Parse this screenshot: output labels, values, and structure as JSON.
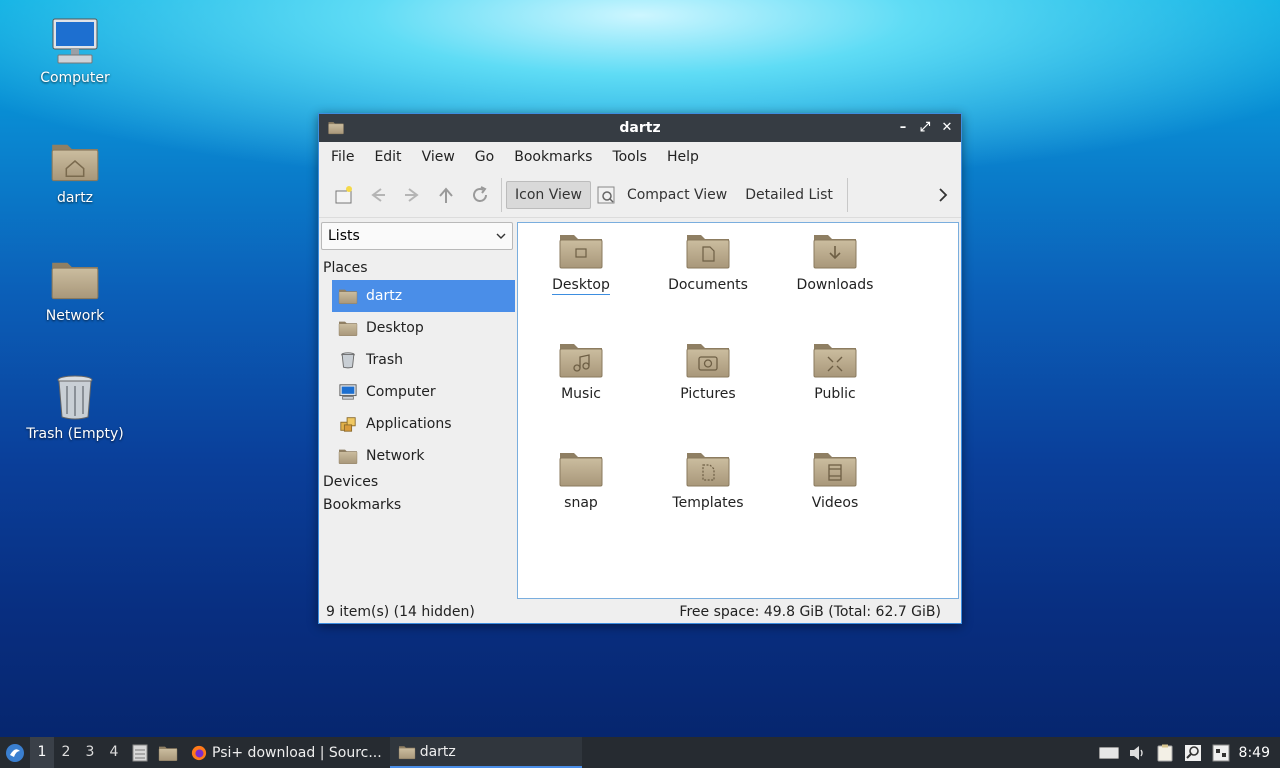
{
  "desktop": {
    "icons": [
      {
        "label": "Computer"
      },
      {
        "label": "dartz"
      },
      {
        "label": "Network"
      },
      {
        "label": "Trash (Empty)"
      }
    ]
  },
  "window": {
    "title": "dartz",
    "menu": [
      "File",
      "Edit",
      "View",
      "Go",
      "Bookmarks",
      "Tools",
      "Help"
    ],
    "toolbar": {
      "icon_view": "Icon View",
      "compact_view": "Compact View",
      "detailed_list": "Detailed List"
    },
    "sidebar": {
      "mode": "Lists",
      "places_header": "Places",
      "places": [
        "dartz",
        "Desktop",
        "Trash",
        "Computer",
        "Applications",
        "Network"
      ],
      "devices_header": "Devices",
      "bookmarks_header": "Bookmarks"
    },
    "files": [
      "Desktop",
      "Documents",
      "Downloads",
      "Music",
      "Pictures",
      "Public",
      "snap",
      "Templates",
      "Videos"
    ],
    "status": {
      "items": "9 item(s) (14 hidden)",
      "free_space": "Free space: 49.8 GiB (Total: 62.7 GiB)"
    }
  },
  "taskbar": {
    "workspaces": [
      "1",
      "2",
      "3",
      "4"
    ],
    "tasks": [
      "Psi+ download | Sourc...",
      "dartz"
    ],
    "clock": "8:49"
  },
  "colors": {
    "accent": "#4a8ee8",
    "titlebar": "#363c43",
    "taskbar": "#262b31",
    "folder": "#b8a88a"
  }
}
